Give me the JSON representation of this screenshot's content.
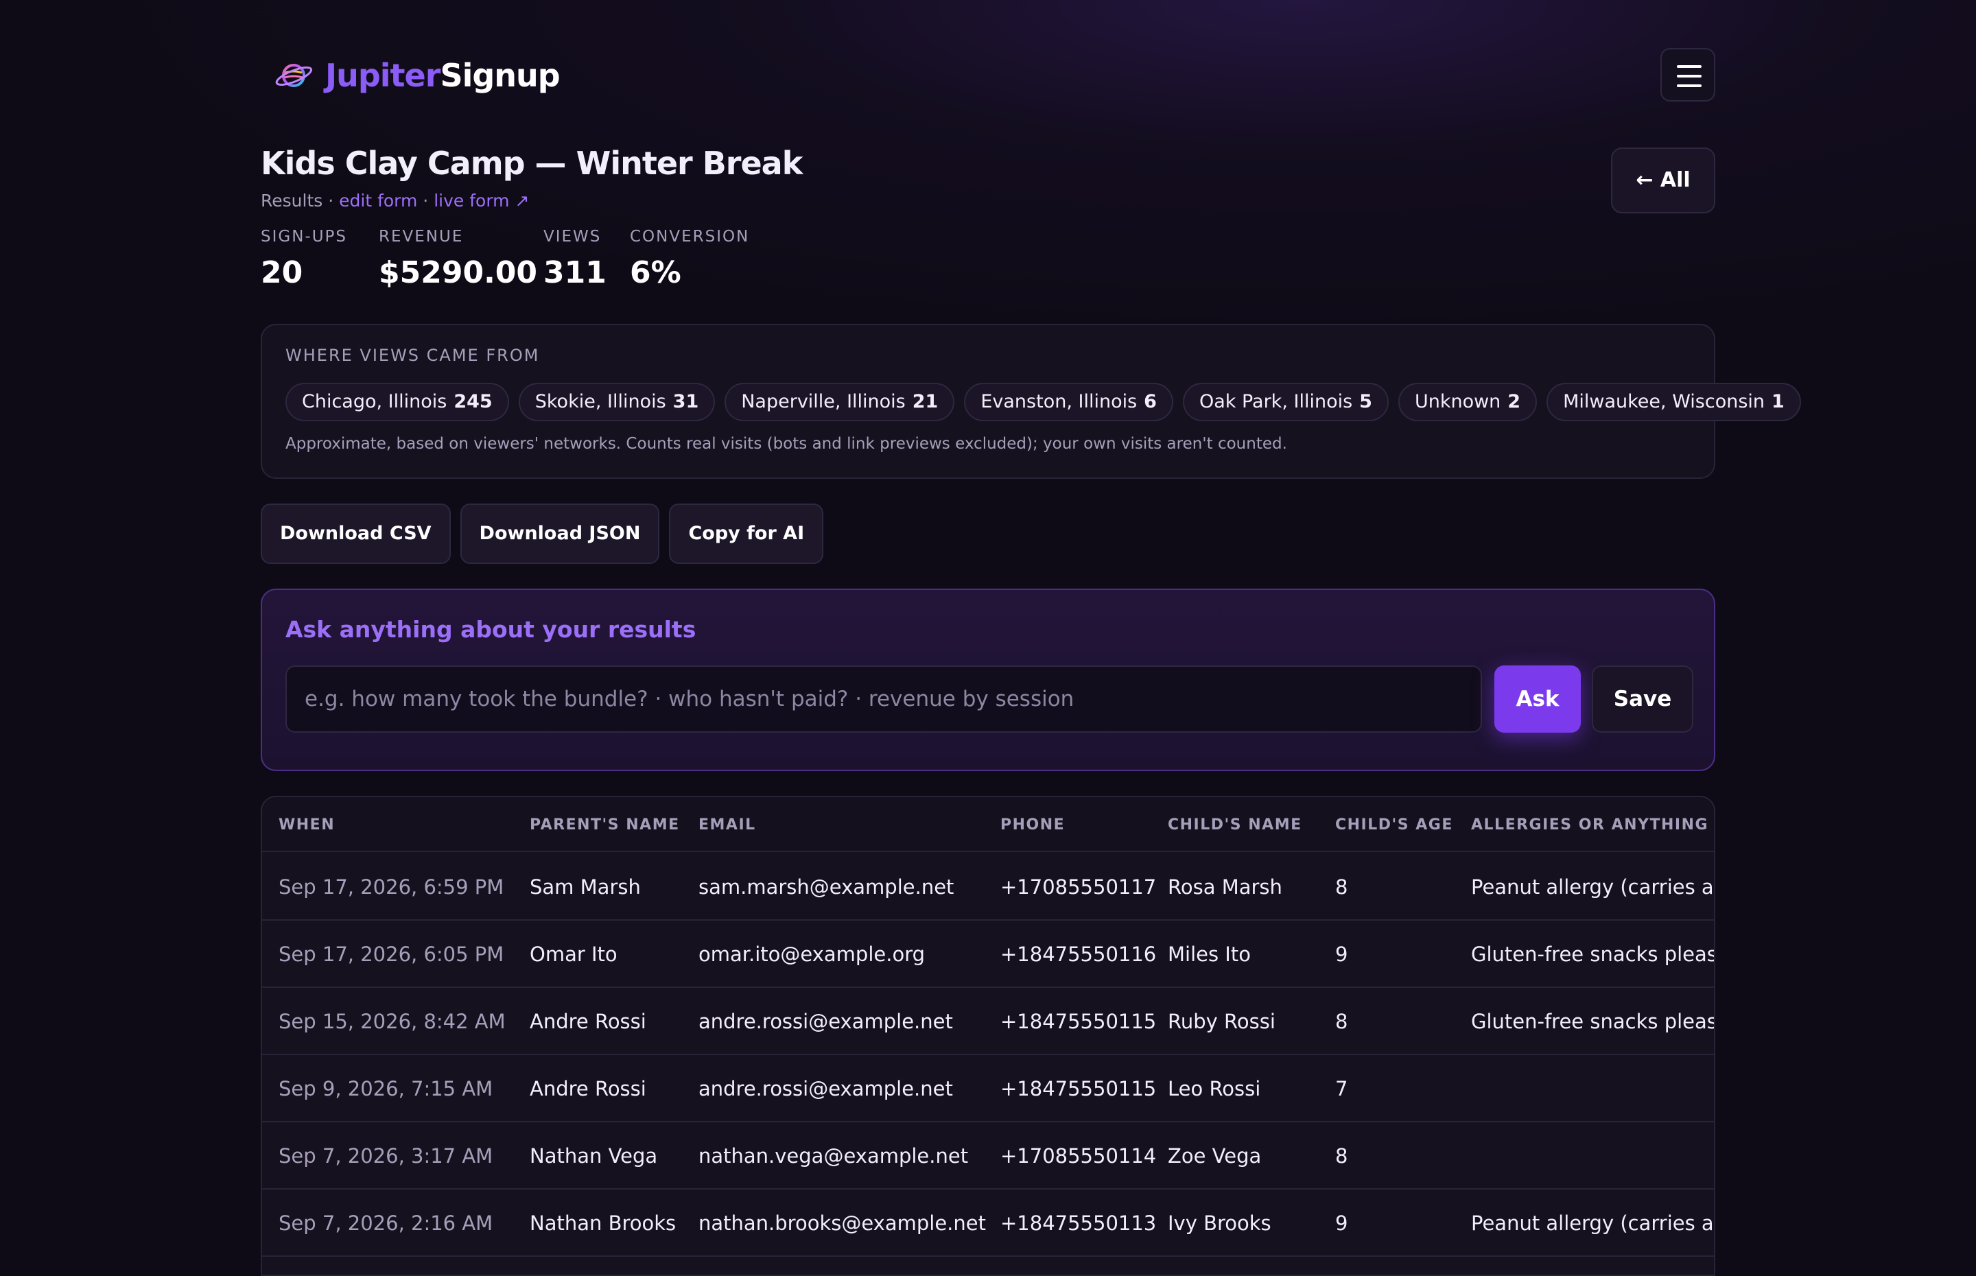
{
  "header": {
    "brand_part1": "Jupiter",
    "brand_part2": "Signup",
    "menu_icon": "hamburger-menu-icon"
  },
  "form": {
    "title": "Kids Clay Camp — Winter Break",
    "sub_prefix": "Results · ",
    "edit_link": "edit form",
    "separator": " · ",
    "live_link": "live form ↗",
    "back_button": "← All"
  },
  "stats": [
    {
      "label": "SIGN-UPS",
      "value": "20"
    },
    {
      "label": "REVENUE",
      "value": "$5290.00"
    },
    {
      "label": "VIEWS",
      "value": "311"
    },
    {
      "label": "CONVERSION",
      "value": "6%"
    }
  ],
  "views": {
    "heading": "WHERE VIEWS CAME FROM",
    "locations": [
      {
        "name": "Chicago, Illinois",
        "count": "245"
      },
      {
        "name": "Skokie, Illinois",
        "count": "31"
      },
      {
        "name": "Naperville, Illinois",
        "count": "21"
      },
      {
        "name": "Evanston, Illinois",
        "count": "6"
      },
      {
        "name": "Oak Park, Illinois",
        "count": "5"
      },
      {
        "name": "Unknown",
        "count": "2"
      },
      {
        "name": "Milwaukee, Wisconsin",
        "count": "1"
      }
    ],
    "note": "Approximate, based on viewers' networks. Counts real visits (bots and link previews excluded); your own visits aren't counted."
  },
  "actions": {
    "csv": "Download CSV",
    "json": "Download JSON",
    "ai": "Copy for AI"
  },
  "ask": {
    "title": "Ask anything about your results",
    "placeholder": "e.g. how many took the bundle? · who hasn't paid? · revenue by session",
    "ask_button": "Ask",
    "save_button": "Save"
  },
  "table": {
    "columns": [
      "WHEN",
      "PARENT'S NAME",
      "EMAIL",
      "PHONE",
      "CHILD'S NAME",
      "CHILD'S AGE",
      "ALLERGIES OR ANYTHING WE"
    ],
    "rows": [
      [
        "Sep 17, 2026, 6:59 PM",
        "Sam Marsh",
        "sam.marsh@example.net",
        "+17085550117",
        "Rosa Marsh",
        "8",
        "Peanut allergy (carries an E"
      ],
      [
        "Sep 17, 2026, 6:05 PM",
        "Omar Ito",
        "omar.ito@example.org",
        "+18475550116",
        "Miles Ito",
        "9",
        "Gluten-free snacks please"
      ],
      [
        "Sep 15, 2026, 8:42 AM",
        "Andre Rossi",
        "andre.rossi@example.net",
        "+18475550115",
        "Ruby Rossi",
        "8",
        "Gluten-free snacks please"
      ],
      [
        "Sep 9, 2026, 7:15 AM",
        "Andre Rossi",
        "andre.rossi@example.net",
        "+18475550115",
        "Leo Rossi",
        "7",
        ""
      ],
      [
        "Sep 7, 2026, 3:17 AM",
        "Nathan Vega",
        "nathan.vega@example.net",
        "+17085550114",
        "Zoe Vega",
        "8",
        ""
      ],
      [
        "Sep 7, 2026, 2:16 AM",
        "Nathan Brooks",
        "nathan.brooks@example.net",
        "+18475550113",
        "Ivy Brooks",
        "9",
        "Peanut allergy (carries an E"
      ]
    ]
  },
  "colors": {
    "accent": "#7c3aed",
    "link": "#9b6ff7",
    "background": "#0e0b16"
  }
}
